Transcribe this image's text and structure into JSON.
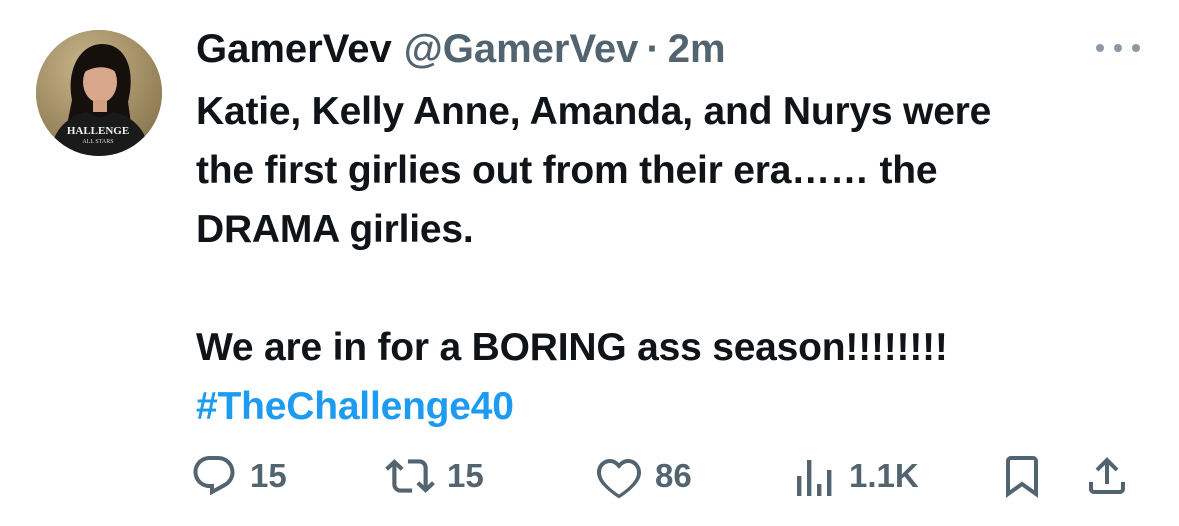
{
  "user": {
    "display_name": "GamerVev",
    "handle": "@GamerVev",
    "separator": "·",
    "time": "2m",
    "avatar_shirt_text": "HALLENGE",
    "avatar_shirt_subtext": "ALL STARS"
  },
  "tweet": {
    "lines": [
      "Katie, Kelly Anne, Amanda, and Nurys were",
      "the first girlies out from their era…… the",
      "DRAMA girlies.",
      "We are in for a BORING ass season!!!!!!!!"
    ],
    "hashtag": "#TheChallenge40"
  },
  "actions": {
    "replies": "15",
    "retweets": "15",
    "likes": "86",
    "views": "1.1K"
  },
  "icons": {
    "more": "more-dots-icon",
    "reply": "reply-bubble-icon",
    "retweet": "retweet-icon",
    "like": "heart-icon",
    "views": "views-bars-icon",
    "bookmark": "bookmark-icon",
    "share": "share-upload-icon"
  },
  "colors": {
    "text": "#0f1419",
    "secondary": "#536471",
    "link": "#1d9bf0",
    "background": "#ffffff"
  }
}
